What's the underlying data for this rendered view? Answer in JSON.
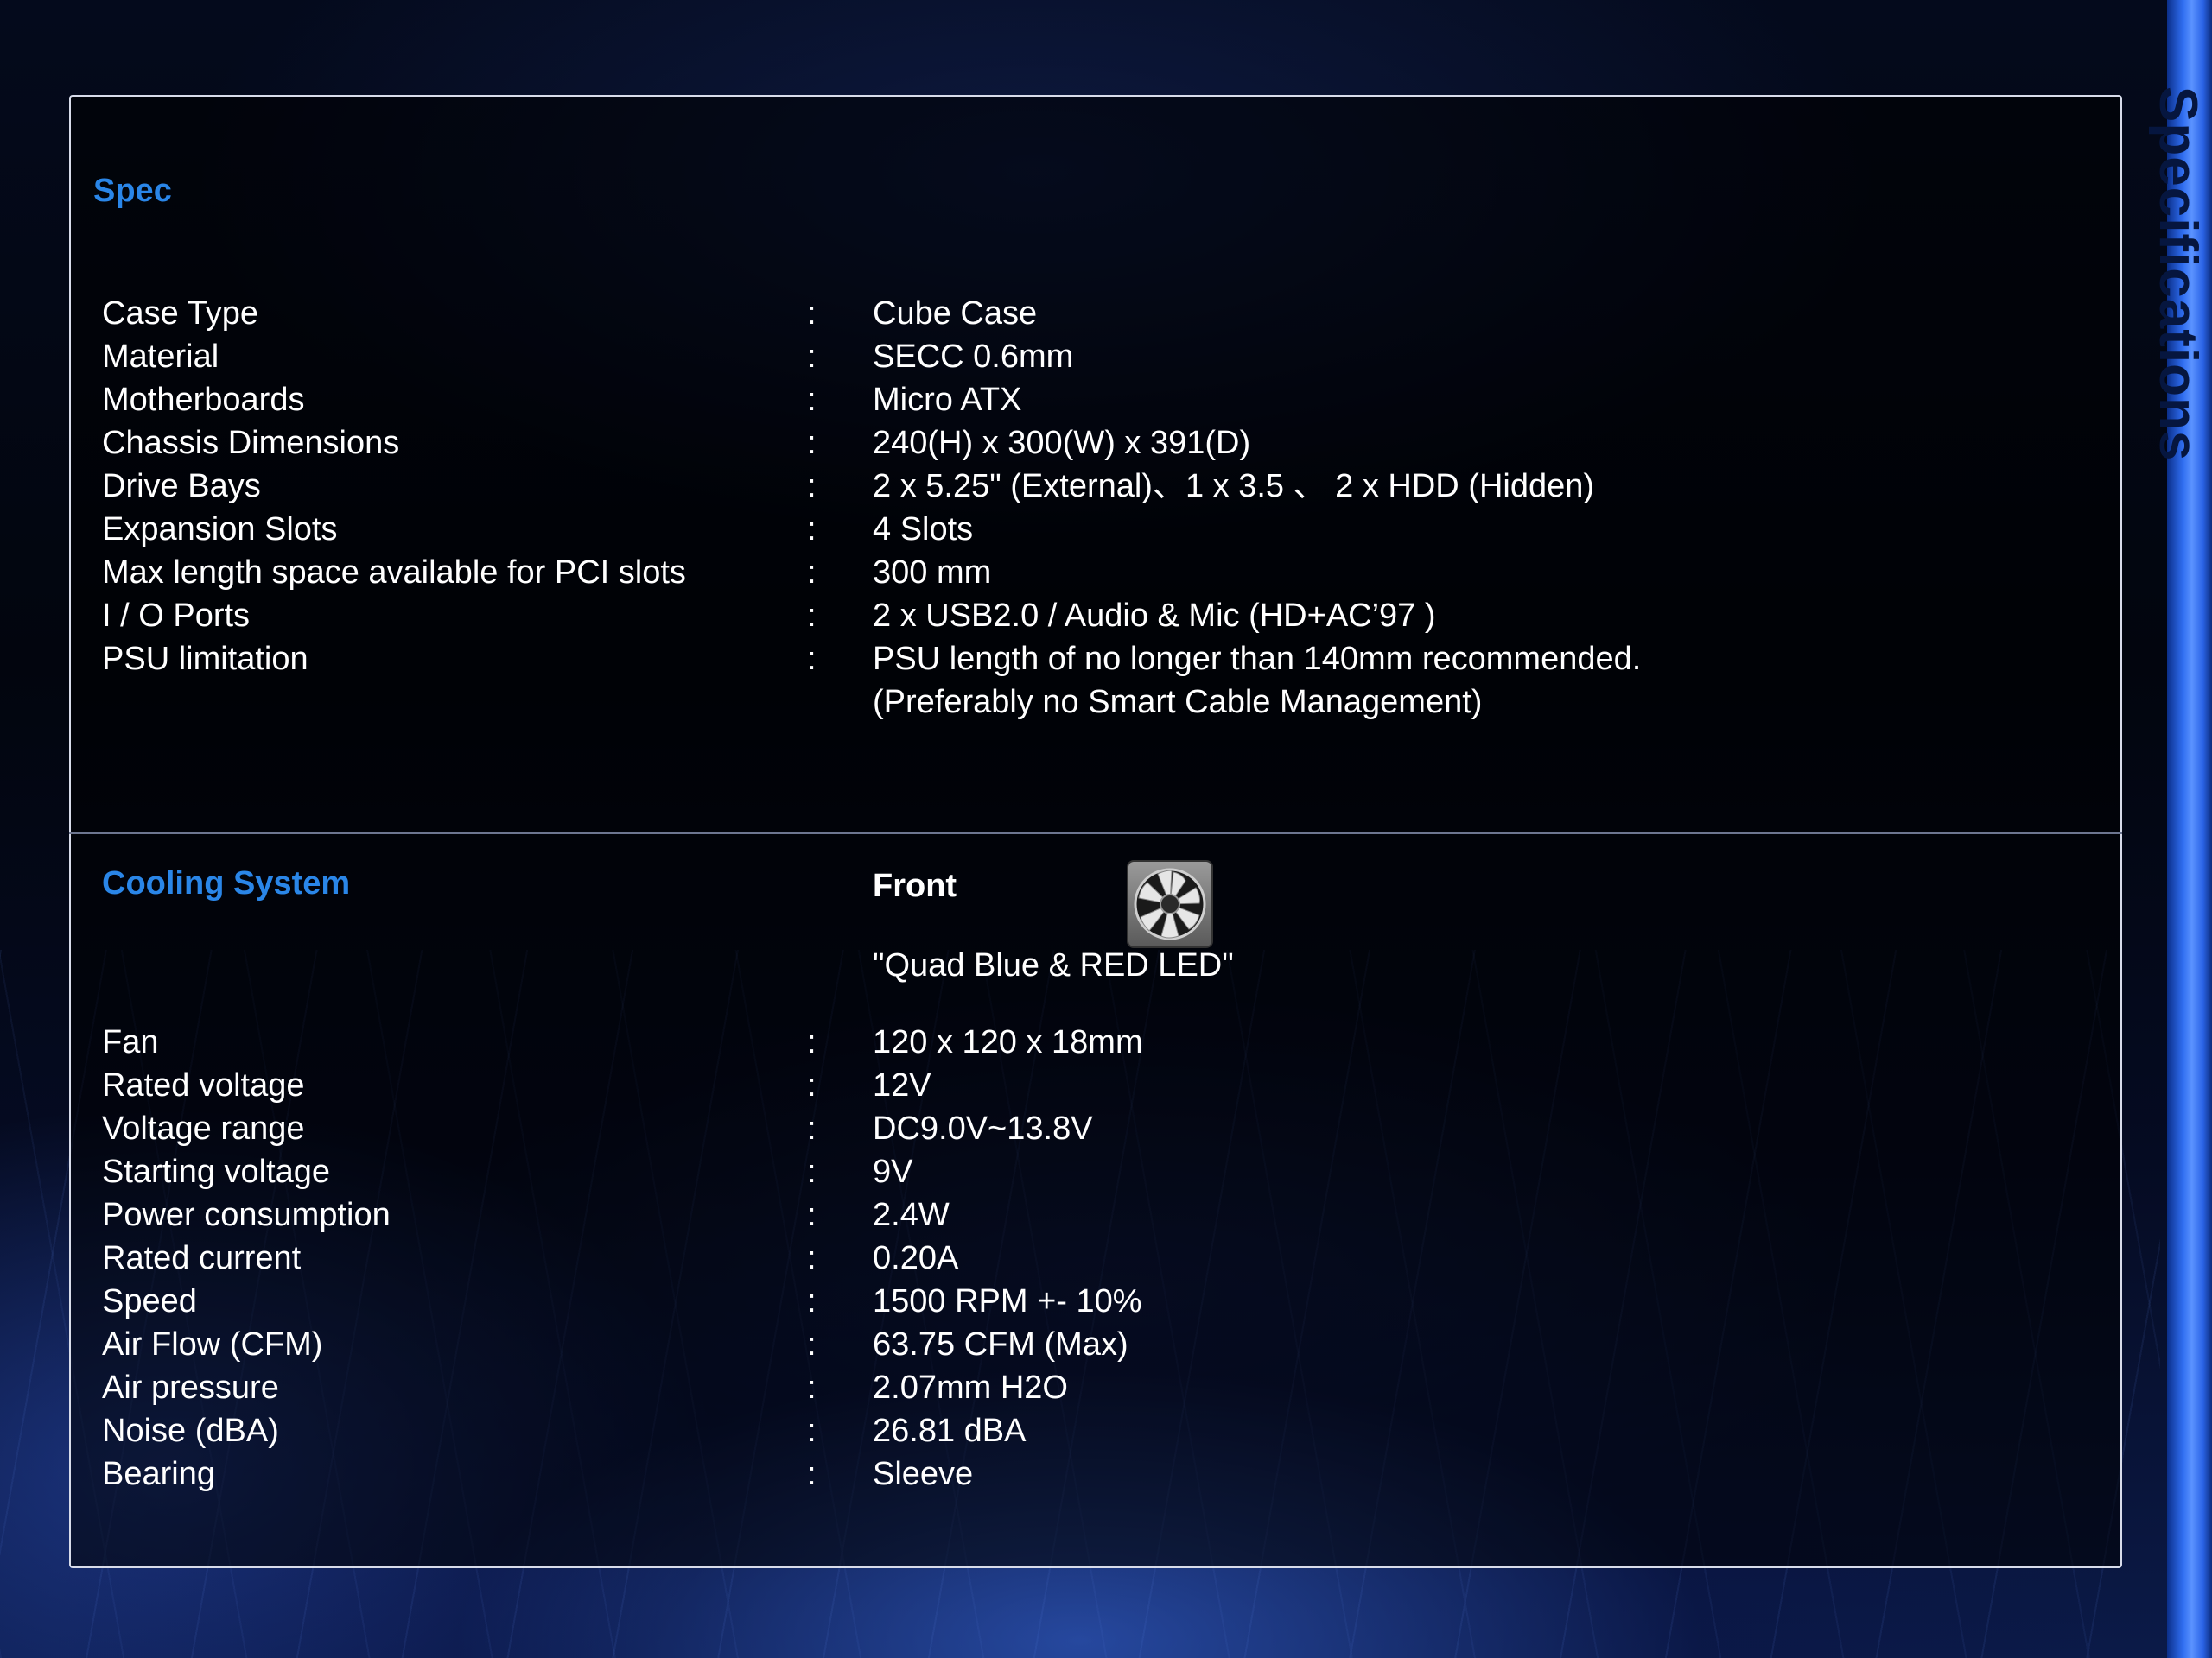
{
  "side_title": "Specifications",
  "spec": {
    "heading": "Spec",
    "rows": [
      {
        "label": "Case Type",
        "sep": ":",
        "value": "Cube Case"
      },
      {
        "label": "Material",
        "sep": ":",
        "value": "SECC 0.6mm"
      },
      {
        "label": "Motherboards",
        "sep": ":",
        "value": "Micro ATX"
      },
      {
        "label": "Chassis Dimensions",
        "sep": ":",
        "value": "240(H) x 300(W) x 391(D)"
      },
      {
        "label": "Drive Bays",
        "sep": ":",
        "value": "2 x 5.25\" (External)、1 x 3.5 、 2 x HDD (Hidden)"
      },
      {
        "label": "Expansion Slots",
        "sep": ":",
        "value": "4 Slots"
      },
      {
        "label": "Max length space available for PCI slots",
        "sep": ":",
        "value": "300 mm"
      },
      {
        "label": "I / O Ports",
        "sep": ":",
        "value": "2 x USB2.0 / Audio & Mic (HD+AC’97 )"
      },
      {
        "label": "PSU limitation",
        "sep": ":",
        "value": "PSU length of no longer than 140mm recommended."
      }
    ],
    "psu_note": "(Preferably no Smart Cable Management)"
  },
  "cooling": {
    "heading": "Cooling System",
    "fan_position": "Front",
    "fan_model": "\"Quad Blue & RED LED\"",
    "fan_icon": "fan-icon",
    "rows": [
      {
        "label": "Fan",
        "sep": ":",
        "value": "120 x 120 x 18mm"
      },
      {
        "label": "Rated voltage",
        "sep": ":",
        "value": "12V"
      },
      {
        "label": "Voltage range",
        "sep": ":",
        "value": "DC9.0V~13.8V"
      },
      {
        "label": "Starting voltage",
        "sep": ":",
        "value": "9V"
      },
      {
        "label": "Power consumption",
        "sep": ":",
        "value": "2.4W"
      },
      {
        "label": "Rated current",
        "sep": ":",
        "value": "0.20A"
      },
      {
        "label": "Speed",
        "sep": ":",
        "value": "1500 RPM +- 10%"
      },
      {
        "label": "Air Flow (CFM)",
        "sep": ":",
        "value": "63.75 CFM (Max)"
      },
      {
        "label": "Air pressure",
        "sep": ":",
        "value": "2.07mm H2O"
      },
      {
        "label": "Noise (dBA)",
        "sep": ":",
        "value": "26.81 dBA"
      },
      {
        "label": "Bearing",
        "sep": ":",
        "value": "Sleeve"
      }
    ]
  }
}
